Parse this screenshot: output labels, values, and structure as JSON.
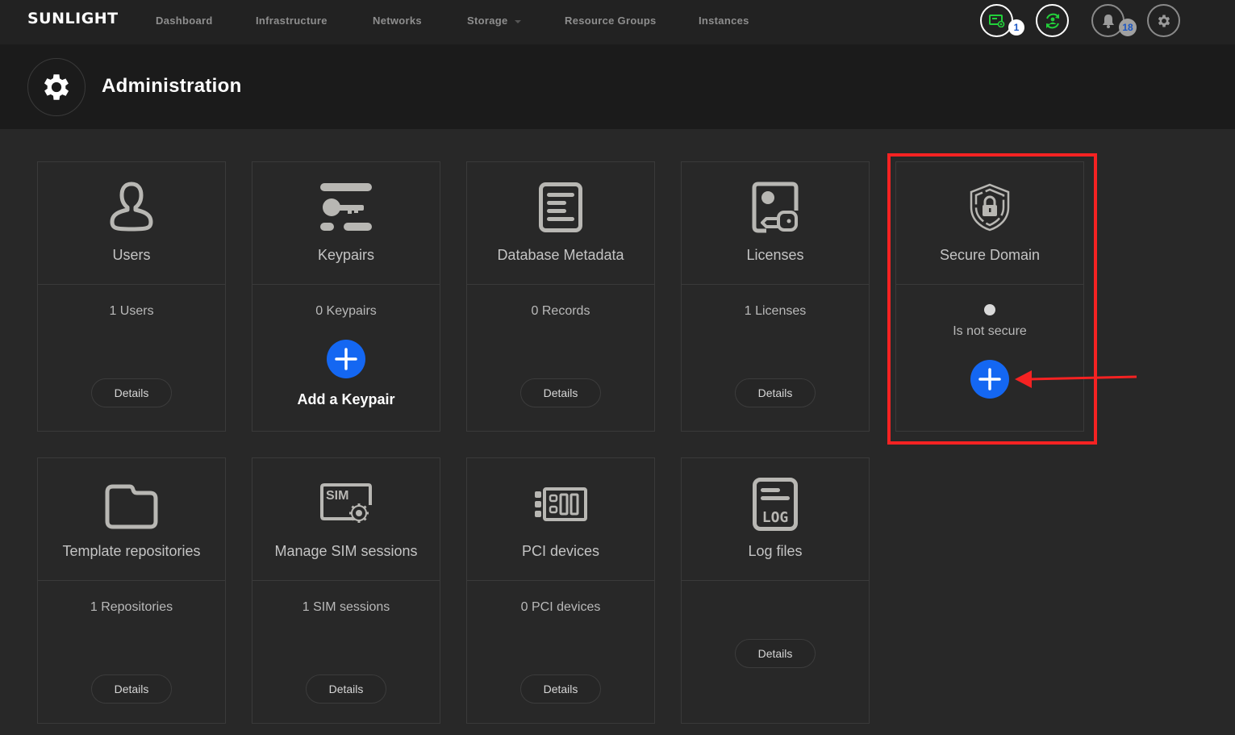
{
  "brand": {
    "logo_text": "SUNLIGHT"
  },
  "nav": {
    "items": [
      {
        "label": "Dashboard"
      },
      {
        "label": "Infrastructure"
      },
      {
        "label": "Networks"
      },
      {
        "label": "Storage",
        "has_dropdown": true
      },
      {
        "label": "Resource Groups"
      },
      {
        "label": "Instances"
      }
    ]
  },
  "header_actions": {
    "sim": {
      "icon": "sim-settings-icon",
      "badge": "1",
      "color": "#22d13a"
    },
    "sync_user": {
      "icon": "user-sync-icon",
      "color": "#22d13a"
    },
    "notifications": {
      "icon": "bell-icon",
      "badge": "18"
    },
    "settings": {
      "icon": "gear-icon"
    }
  },
  "page": {
    "title": "Administration",
    "icon": "gear-icon"
  },
  "cards": [
    {
      "id": "users",
      "icon": "user-icon",
      "title": "Users",
      "count": "1 Users",
      "action": "Details"
    },
    {
      "id": "keypairs",
      "icon": "key-list-icon",
      "title": "Keypairs",
      "count": "0 Keypairs",
      "add_label": "Add a Keypair"
    },
    {
      "id": "database-metadata",
      "icon": "document-icon",
      "title": "Database Metadata",
      "count": "0 Records",
      "action": "Details"
    },
    {
      "id": "licenses",
      "icon": "license-key-icon",
      "title": "Licenses",
      "count": "1 Licenses",
      "action": "Details"
    },
    {
      "id": "secure-domain",
      "icon": "shield-lock-icon",
      "title": "Secure Domain",
      "status": "Is not secure",
      "status_color": "#d9d9d9"
    },
    {
      "id": "template-repositories",
      "icon": "folder-icon",
      "title": "Template repositories",
      "count": "1 Repositories",
      "action": "Details"
    },
    {
      "id": "sim-sessions",
      "icon": "sim-settings-icon",
      "title": "Manage SIM sessions",
      "count": "1 SIM sessions",
      "action": "Details",
      "icon_text": "SIM"
    },
    {
      "id": "pci-devices",
      "icon": "pci-card-icon",
      "title": "PCI devices",
      "count": "0 PCI devices",
      "action": "Details"
    },
    {
      "id": "log-files",
      "icon": "log-file-icon",
      "title": "Log files",
      "action": "Details",
      "icon_text": "LOG"
    }
  ],
  "annotation": {
    "highlight_color": "#f52222",
    "target": "secure-domain add button"
  },
  "colors": {
    "accent_blue": "#1467f2",
    "green": "#22d13a"
  }
}
